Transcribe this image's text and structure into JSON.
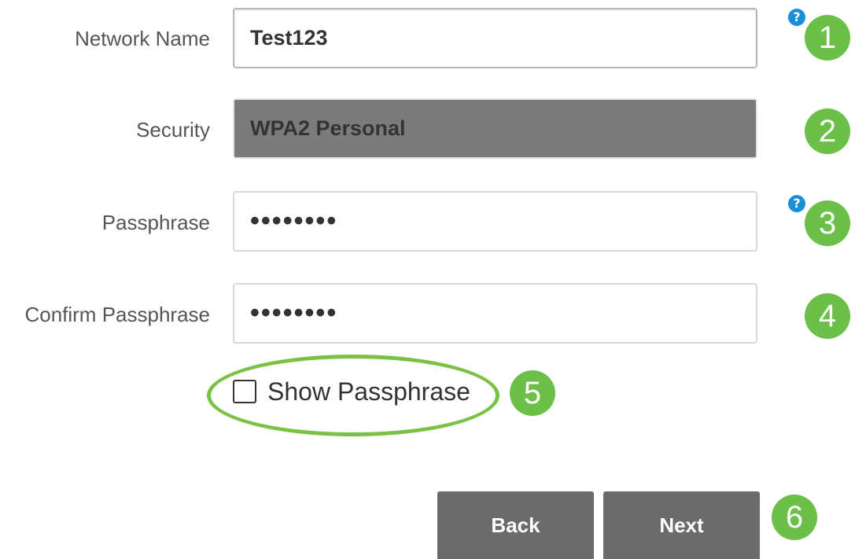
{
  "form": {
    "network_name": {
      "label": "Network Name",
      "value": "Test123"
    },
    "security": {
      "label": "Security",
      "value": "WPA2 Personal"
    },
    "passphrase": {
      "label": "Passphrase",
      "value": "••••••••"
    },
    "confirm_passphrase": {
      "label": "Confirm Passphrase",
      "value": "••••••••"
    },
    "show_passphrase": {
      "label": "Show Passphrase",
      "checked": false
    }
  },
  "buttons": {
    "back": "Back",
    "next": "Next"
  },
  "help_icons": {
    "glyph": "?",
    "color": "#1a8fd6"
  },
  "step_badges": {
    "color": "#6cc04a",
    "labels": [
      "1",
      "2",
      "3",
      "4",
      "5",
      "6"
    ]
  }
}
